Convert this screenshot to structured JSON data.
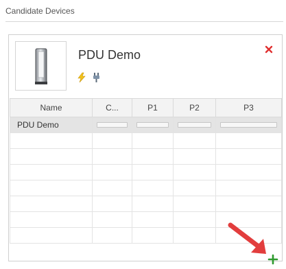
{
  "section": {
    "title": "Candidate Devices"
  },
  "device": {
    "name": "PDU Demo",
    "icons": [
      "rack-server-icon",
      "power-bolt-icon",
      "plug-icon"
    ]
  },
  "table": {
    "columns": [
      "Name",
      "C...",
      "P1",
      "P2",
      "P3"
    ],
    "rows": [
      {
        "name": "PDU Demo",
        "selected": true
      }
    ],
    "empty_rows": 7
  },
  "colors": {
    "close": "#e03030",
    "add": "#2e9a2e",
    "arrow": "#e23d3d",
    "bolt": "#f2c21a"
  },
  "actions": {
    "close_icon": "close-icon",
    "add_icon": "add-plus-icon"
  }
}
